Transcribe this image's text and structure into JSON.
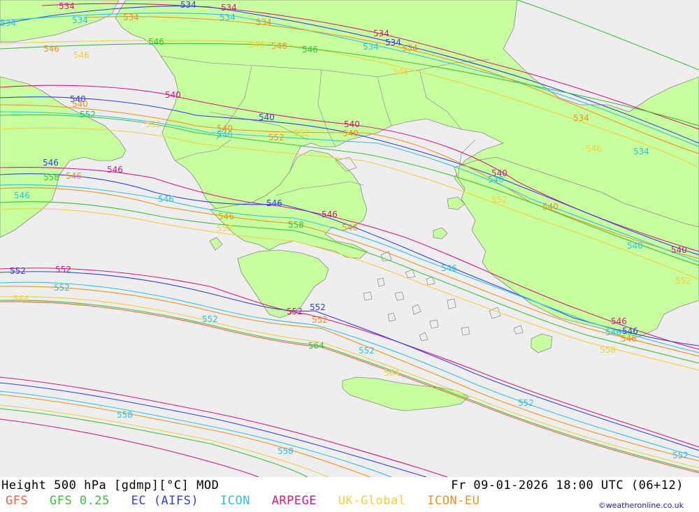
{
  "header": {
    "title": "Height 500 hPa [gdmp][°C] MOD",
    "datetime": "Fr 09-01-2026 18:00 UTC (06+12)",
    "credit": "©weatheronline.co.uk"
  },
  "models": [
    {
      "name": "GFS",
      "color": "#ff5a3c"
    },
    {
      "name": "GFS 0.25",
      "color": "#36c236"
    },
    {
      "name": "EC (AIFS)",
      "color": "#2f3ff0"
    },
    {
      "name": "ICON",
      "color": "#2bc2e8"
    },
    {
      "name": "ARPEGE",
      "color": "#d6197d"
    },
    {
      "name": "UK-Global",
      "color": "#f2d03a"
    },
    {
      "name": "ICON-EU",
      "color": "#f0901c"
    }
  ],
  "colors": {
    "sea": "#eeeeee",
    "land": "#c8ff9e",
    "coast": "#888888",
    "border": "#999999"
  },
  "contour_labels": [
    {
      "text": "534",
      "color": "#d6197d"
    },
    {
      "text": "534",
      "color": "#2f3ff0"
    },
    {
      "text": "534",
      "color": "#d6197d"
    },
    {
      "text": "534",
      "color": "#f0901c"
    },
    {
      "text": "534",
      "color": "#2bc2e8"
    },
    {
      "text": "534",
      "color": "#f0901c"
    },
    {
      "text": "534",
      "color": "#d6197d"
    },
    {
      "text": "534",
      "color": "#2f3ff0"
    },
    {
      "text": "534",
      "color": "#2bc2e8"
    },
    {
      "text": "534",
      "color": "#f0901c"
    },
    {
      "text": "534",
      "color": "#2bc2e8"
    },
    {
      "text": "534",
      "color": "#f0901c"
    },
    {
      "text": "534",
      "color": "#2bc2e8"
    },
    {
      "text": "546",
      "color": "#f0901c"
    },
    {
      "text": "546",
      "color": "#f2d03a"
    },
    {
      "text": "546",
      "color": "#36c236"
    },
    {
      "text": "546",
      "color": "#f2d03a"
    },
    {
      "text": "546",
      "color": "#f0901c"
    },
    {
      "text": "546",
      "color": "#36c236"
    },
    {
      "text": "546",
      "color": "#f2d03a"
    },
    {
      "text": "540",
      "color": "#2f3ff0"
    },
    {
      "text": "540",
      "color": "#f0901c"
    },
    {
      "text": "552",
      "color": "#36c236"
    },
    {
      "text": "540",
      "color": "#d6197d"
    },
    {
      "text": "552",
      "color": "#f2d03a"
    },
    {
      "text": "540",
      "color": "#2f3ff0"
    },
    {
      "text": "540",
      "color": "#f0901c"
    },
    {
      "text": "540",
      "color": "#2bc2e8"
    },
    {
      "text": "552",
      "color": "#f0901c"
    },
    {
      "text": "552",
      "color": "#f2d03a"
    },
    {
      "text": "540",
      "color": "#d6197d"
    },
    {
      "text": "540",
      "color": "#f0901c"
    },
    {
      "text": "546",
      "color": "#f2d03a"
    },
    {
      "text": "534",
      "color": "#2bc2e8"
    },
    {
      "text": "546",
      "color": "#2f3ff0"
    },
    {
      "text": "558",
      "color": "#36c236"
    },
    {
      "text": "546",
      "color": "#f0901c"
    },
    {
      "text": "546",
      "color": "#d6197d"
    },
    {
      "text": "546",
      "color": "#2bc2e8"
    },
    {
      "text": "540",
      "color": "#d6197d"
    },
    {
      "text": "540",
      "color": "#2bc2e8"
    },
    {
      "text": "552",
      "color": "#f2d03a"
    },
    {
      "text": "540",
      "color": "#f0901c"
    },
    {
      "text": "546",
      "color": "#2f3ff0"
    },
    {
      "text": "546",
      "color": "#f0901c"
    },
    {
      "text": "546",
      "color": "#2bc2e8"
    },
    {
      "text": "546",
      "color": "#d6197d"
    },
    {
      "text": "558",
      "color": "#36c236"
    },
    {
      "text": "546",
      "color": "#f0901c"
    },
    {
      "text": "558",
      "color": "#f2d03a"
    },
    {
      "text": "546",
      "color": "#2bc2e8"
    },
    {
      "text": "540",
      "color": "#2bc2e8"
    },
    {
      "text": "540",
      "color": "#d6197d"
    },
    {
      "text": "552",
      "color": "#f2d03a"
    },
    {
      "text": "552",
      "color": "#2f3ff0"
    },
    {
      "text": "552",
      "color": "#d6197d"
    },
    {
      "text": "552",
      "color": "#2bc2e8"
    },
    {
      "text": "564",
      "color": "#f2d03a"
    },
    {
      "text": "552",
      "color": "#2bc2e8"
    },
    {
      "text": "552",
      "color": "#d6197d"
    },
    {
      "text": "552",
      "color": "#2f3ff0"
    },
    {
      "text": "552",
      "color": "#f0901c"
    },
    {
      "text": "564",
      "color": "#36c236"
    },
    {
      "text": "552",
      "color": "#2bc2e8"
    },
    {
      "text": "564",
      "color": "#f2d03a"
    },
    {
      "text": "546",
      "color": "#d6197d"
    },
    {
      "text": "546",
      "color": "#2bc2e8"
    },
    {
      "text": "546",
      "color": "#2f3ff0"
    },
    {
      "text": "546",
      "color": "#f0901c"
    },
    {
      "text": "558",
      "color": "#f2d03a"
    },
    {
      "text": "552",
      "color": "#2bc2e8"
    },
    {
      "text": "558",
      "color": "#2bc2e8"
    },
    {
      "text": "558",
      "color": "#2bc2e8"
    },
    {
      "text": "552",
      "color": "#2bc2e8"
    }
  ]
}
